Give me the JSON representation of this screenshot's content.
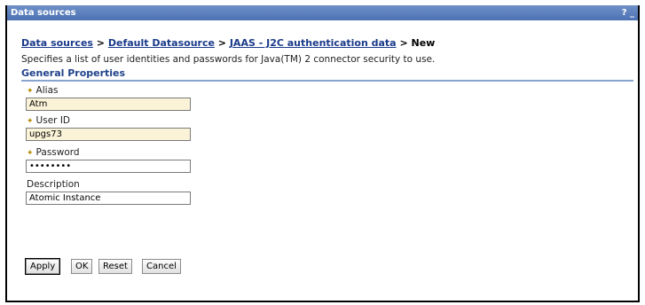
{
  "window": {
    "title": "Data sources",
    "controls": "? _"
  },
  "breadcrumb": {
    "crumbs": [
      "Data sources",
      "Default Datasource",
      "JAAS - J2C authentication data"
    ],
    "separator": ">",
    "current": "New"
  },
  "description": "Specifies a list of user identities and passwords for Java(TM) 2 connector security to use.",
  "section_title": "General Properties",
  "fields": {
    "alias": {
      "label": "Alias",
      "value": "Atm",
      "required": true
    },
    "user_id": {
      "label": "User ID",
      "value": "upgs73",
      "required": true
    },
    "password": {
      "label": "Password",
      "value": "••••••••",
      "required": true
    },
    "description": {
      "label": "Description",
      "value": "Atomic Instance",
      "required": false
    }
  },
  "required_marker": "✦",
  "buttons": {
    "apply": "Apply",
    "ok": "OK",
    "reset": "Reset",
    "cancel": "Cancel"
  }
}
